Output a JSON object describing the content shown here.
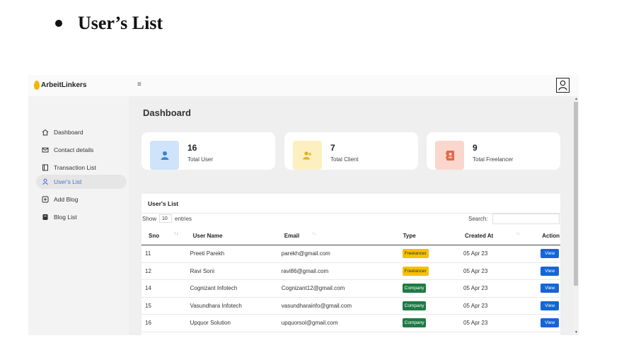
{
  "doc": {
    "heading": "User’s List"
  },
  "app": {
    "brand": "ArbeitLinkers",
    "menu_toggle": "≡",
    "sidebar": {
      "items": [
        {
          "label": "Dashboard",
          "icon": "home-icon"
        },
        {
          "label": "Contact details",
          "icon": "mail-icon"
        },
        {
          "label": "Transaction List",
          "icon": "document-icon"
        },
        {
          "label": "User's List",
          "icon": "user-icon",
          "active": true
        },
        {
          "label": "Add Blog",
          "icon": "plus-square-icon"
        },
        {
          "label": "Blog List",
          "icon": "book-icon"
        }
      ]
    },
    "page_title": "Dashboard",
    "cards": [
      {
        "value": "16",
        "label": "Total User",
        "color": "#cfe3fa",
        "icon_color": "#3b82d6",
        "icon": "user-icon"
      },
      {
        "value": "7",
        "label": "Total Client",
        "color": "#fdf0c0",
        "icon_color": "#e0b020",
        "icon": "users-icon"
      },
      {
        "value": "9",
        "label": "Total Freelancer",
        "color": "#fbd6cc",
        "icon_color": "#e06a4a",
        "icon": "contact-book-icon"
      }
    ],
    "users_panel": {
      "title": "User's List",
      "show_label": "Show",
      "entries_value": "10",
      "entries_label": "entries",
      "search_label": "Search:",
      "columns": [
        "Sno",
        "User Name",
        "Email",
        "Type",
        "Created At",
        "Action"
      ],
      "rows": [
        {
          "sno": "11",
          "name": "Preeti Parekh",
          "email": "parekh@gmail.com",
          "type": "Freelancer",
          "created": "05 Apr 23",
          "action": "View"
        },
        {
          "sno": "12",
          "name": "Ravi Soni",
          "email": "ravi86@gmail.com",
          "type": "Freelancer",
          "created": "05 Apr 23",
          "action": "View"
        },
        {
          "sno": "14",
          "name": "Cognizant Infotech",
          "email": "Cognizant12@gmail.com",
          "type": "Company",
          "created": "05 Apr 23",
          "action": "View"
        },
        {
          "sno": "15",
          "name": "Vasundhara Infotech",
          "email": "vasundharainfo@gmail.com",
          "type": "Company",
          "created": "05 Apr 23",
          "action": "View"
        },
        {
          "sno": "16",
          "name": "Upquor Solution",
          "email": "upquorsol@gmail.com",
          "type": "Company",
          "created": "05 Apr 23",
          "action": "View"
        }
      ]
    }
  }
}
